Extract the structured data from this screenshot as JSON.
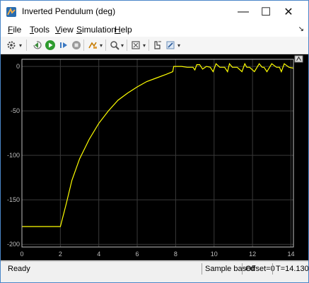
{
  "window": {
    "title": "Inverted Pendulum (deg)",
    "minimize_glyph": "—",
    "maximize_glyph": "☐",
    "close_glyph": "✕"
  },
  "menu": {
    "items": [
      {
        "label": "File",
        "key": "F",
        "rest": "ile"
      },
      {
        "label": "Tools",
        "key": "T",
        "rest": "ools"
      },
      {
        "label": "View",
        "key": "V",
        "rest": "iew"
      },
      {
        "label": "Simulation",
        "key": "S",
        "rest": "imulation"
      },
      {
        "label": "Help",
        "key": "H",
        "rest": "elp"
      }
    ],
    "overflow_glyph": "↘"
  },
  "toolbar": {
    "icons": [
      "settings-icon",
      "step-back-icon",
      "run-icon",
      "step-forward-icon",
      "stop-icon",
      "highlight-icon",
      "zoom-icon",
      "fit-to-view-icon",
      "cursor-measure-icon",
      "style-icon"
    ]
  },
  "status": {
    "ready": "Ready",
    "mode": "Sample based",
    "offset": "Offset=0",
    "time": "T=14.130"
  },
  "colors": {
    "plot_bg": "#000000",
    "axes_bg": "#000000",
    "grid": "#3a3a3a",
    "axis": "#bfbfbf",
    "trace": "#ffff00",
    "accent": "#1f6fb5"
  },
  "chart_data": {
    "type": "line",
    "title": "",
    "xlabel": "",
    "ylabel": "",
    "xlim": [
      0,
      14.13
    ],
    "ylim": [
      -203,
      8
    ],
    "xticks": [
      0,
      2,
      4,
      6,
      8,
      10,
      12,
      14
    ],
    "yticks": [
      0,
      -50,
      -100,
      -150,
      -200
    ],
    "grid": true,
    "series": [
      {
        "x": [
          0,
          2.0,
          2.3,
          2.6,
          3.0,
          3.5,
          4.0,
          4.5,
          5.0,
          5.5,
          6.0,
          6.5,
          7.0,
          7.5,
          7.85,
          7.9,
          8.0,
          8.3,
          8.6,
          8.9,
          9.0,
          9.1,
          9.25,
          9.4,
          9.6,
          9.8,
          9.95,
          10.1,
          10.3,
          10.55,
          10.7,
          10.8,
          10.95,
          11.2,
          11.45,
          11.6,
          11.7,
          11.85,
          12.1,
          12.35,
          12.5,
          12.6,
          12.75,
          13.0,
          13.25,
          13.4,
          13.5,
          13.65,
          13.9,
          14.13
        ],
        "y": [
          -180,
          -180,
          -155,
          -128,
          -104,
          -82,
          -64,
          -50,
          -38,
          -30,
          -23,
          -17,
          -13,
          -9,
          -6,
          0,
          0,
          0,
          -1,
          -1,
          -4,
          2,
          2,
          -3,
          0,
          -1,
          -6,
          3,
          -1,
          -1,
          -6,
          3,
          -1,
          -1,
          -6,
          3,
          -1,
          -1,
          -6,
          3,
          -1,
          -1,
          -6,
          3,
          -1,
          -1,
          -6,
          3,
          -1,
          -2
        ]
      }
    ]
  }
}
